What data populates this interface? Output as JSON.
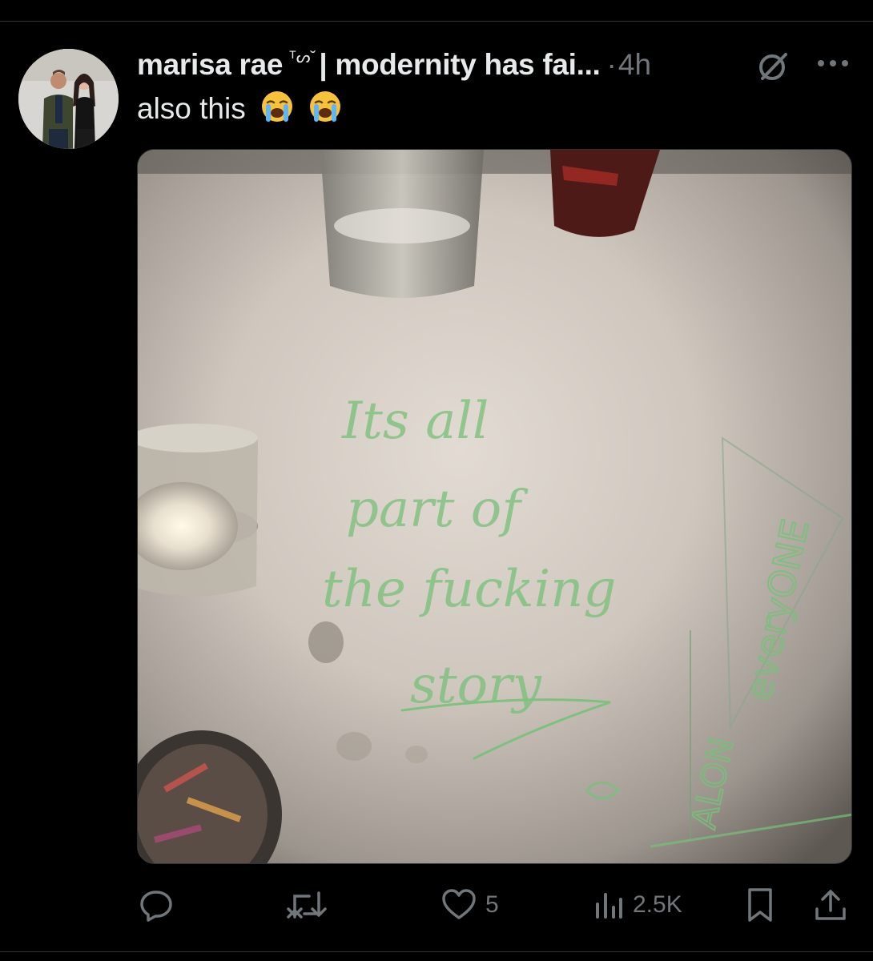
{
  "tweet": {
    "display_name": "marisa rae",
    "name_glyph": "ᵀᔕ˘",
    "name_rest": "| modernity has fai...",
    "separator": "·",
    "time": "4h",
    "text": "also this",
    "emojis": [
      "loudly-crying-face",
      "loudly-crying-face"
    ],
    "avatar": "profile-photo-two-people",
    "media": {
      "description_icon": "photo-handwritten-table",
      "handwriting_lines": [
        "Its all",
        "part of",
        "the fucking",
        "story"
      ],
      "side_handwriting": "everyONE",
      "side_handwriting_2": "ALON"
    }
  },
  "actions": {
    "reply_icon": "reply-icon",
    "retweet_icon": "retweet-icon",
    "like_icon": "heart-icon",
    "like_count": "5",
    "views_icon": "views-icon",
    "views_count": "2.5K",
    "bookmark_icon": "bookmark-icon",
    "share_icon": "share-icon"
  },
  "colors": {
    "background": "#000000",
    "text_primary": "#e7e9ea",
    "text_secondary": "#71767b",
    "divider": "#2f3336",
    "handwriting_green": "#78c07a"
  }
}
